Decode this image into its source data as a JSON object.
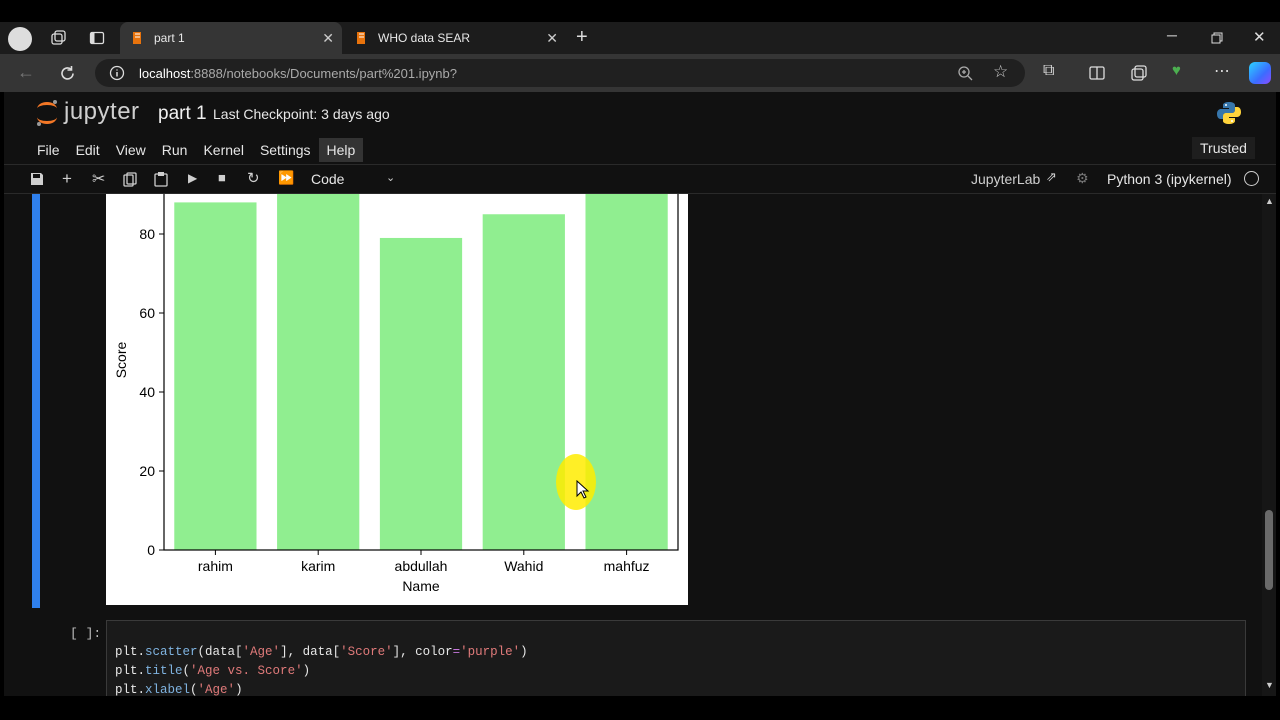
{
  "browser": {
    "tabs": [
      {
        "label": "part 1",
        "active": true
      },
      {
        "label": "WHO data SEAR",
        "active": false
      }
    ],
    "url_host": "localhost",
    "url_path": ":8888/notebooks/Documents/part%201.ipynb?"
  },
  "jupyter": {
    "logo_text": "jupyter",
    "notebook_title": "part 1",
    "checkpoint": "Last Checkpoint: 3 days ago",
    "trusted": "Trusted",
    "menu": [
      "File",
      "Edit",
      "View",
      "Run",
      "Kernel",
      "Settings",
      "Help"
    ],
    "cell_type": "Code",
    "jupyterlab_label": "JupyterLab",
    "kernel": "Python 3 (ipykernel)"
  },
  "chart_data": {
    "type": "bar",
    "categories": [
      "rahim",
      "karim",
      "abdullah",
      "Wahid",
      "mahfuz"
    ],
    "values": [
      88,
      92,
      79,
      85,
      95
    ],
    "xlabel": "Name",
    "ylabel": "Score",
    "yticks": [
      "0",
      "20",
      "40",
      "60",
      "80"
    ],
    "color": "#90ee90",
    "ylim": [
      0,
      90
    ]
  },
  "next_cell": {
    "prompt": "[ ]:",
    "lines": [
      [
        [
          "plt.",
          "plain"
        ],
        [
          "scatter",
          "fn"
        ],
        [
          "(data[",
          "plain"
        ],
        [
          "'Age'",
          "str"
        ],
        [
          "], data[",
          "plain"
        ],
        [
          "'Score'",
          "str"
        ],
        [
          "], color",
          "plain"
        ],
        [
          "=",
          "op"
        ],
        [
          "'purple'",
          "str"
        ],
        [
          ")",
          "plain"
        ]
      ],
      [
        [
          "plt.",
          "plain"
        ],
        [
          "title",
          "fn"
        ],
        [
          "(",
          "plain"
        ],
        [
          "'Age vs. Score'",
          "str"
        ],
        [
          ")",
          "plain"
        ]
      ],
      [
        [
          "plt.",
          "plain"
        ],
        [
          "xlabel",
          "fn"
        ],
        [
          "(",
          "plain"
        ],
        [
          "'Age'",
          "str"
        ],
        [
          ")",
          "plain"
        ]
      ]
    ]
  }
}
